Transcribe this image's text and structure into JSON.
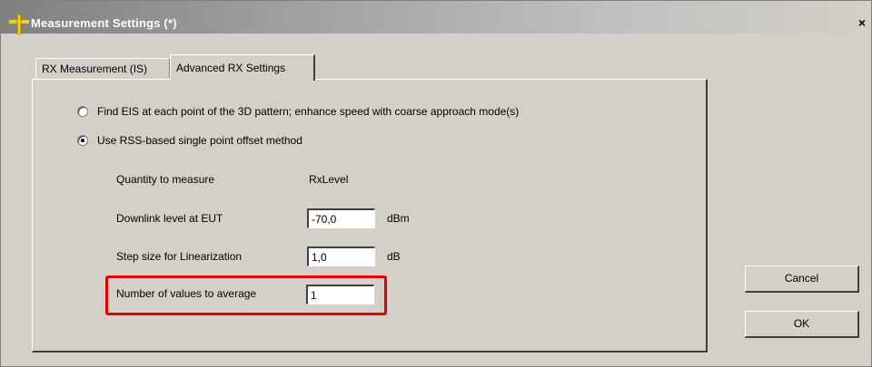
{
  "window": {
    "title": "Measurement Settings (*)",
    "close_glyph": "×"
  },
  "tabs": [
    {
      "label": "RX Measurement (IS)",
      "active": false
    },
    {
      "label": "Advanced RX Settings",
      "active": true
    }
  ],
  "options": {
    "find_eis": {
      "label": "Find EIS at each point of the 3D pattern; enhance speed with coarse approach mode(s)",
      "checked": false
    },
    "rss_offset": {
      "label": "Use RSS-based single point offset method",
      "checked": true
    }
  },
  "settings": {
    "quantity": {
      "label": "Quantity to measure",
      "value": "RxLevel"
    },
    "downlink": {
      "label": "Downlink level at EUT",
      "value": "-70,0",
      "unit": "dBm"
    },
    "step": {
      "label": "Step size for Linearization",
      "value": "1,0",
      "unit": "dB"
    },
    "average": {
      "label": "Number of values to average",
      "value": "1"
    }
  },
  "buttons": {
    "cancel": "Cancel",
    "ok": "OK"
  },
  "colors": {
    "highlight": "#e00000",
    "dialog_bg": "#d4d0c8",
    "icon": "#f0d000"
  },
  "icons": {
    "app": "crosshair-plus-icon"
  }
}
